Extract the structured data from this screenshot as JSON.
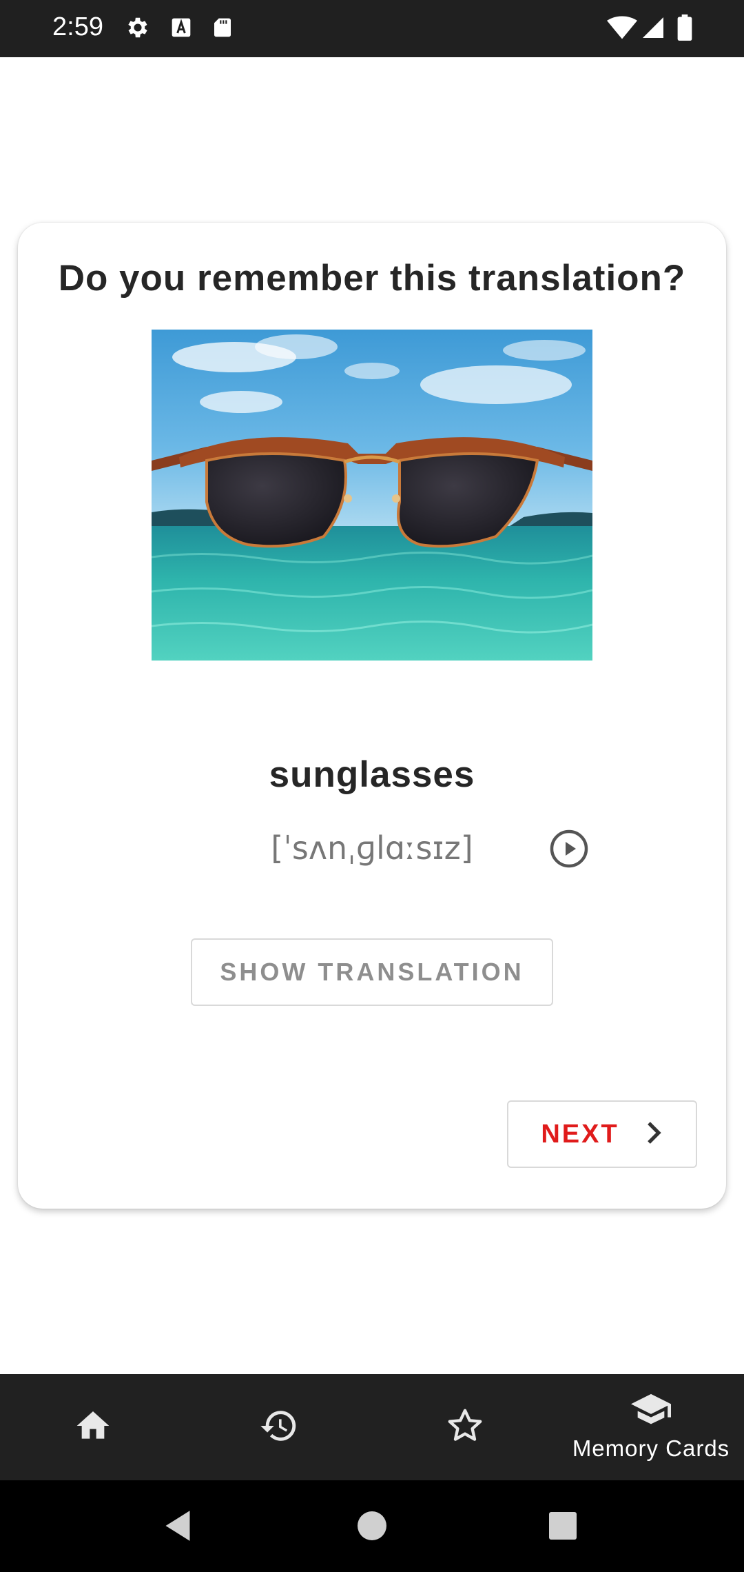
{
  "status_bar": {
    "time": "2:59",
    "icons": [
      "settings-gear-icon",
      "font-a-icon",
      "sd-card-icon",
      "wifi-icon",
      "cell-signal-icon",
      "battery-icon"
    ]
  },
  "card": {
    "question": "Do you remember this translation?",
    "image_subject": "sunglasses over sea",
    "word": "sunglasses",
    "phonetic": "[ˈsʌnˌɡlɑːsɪz]",
    "play_icon": "play-circle-icon",
    "show_translation_label": "SHOW TRANSLATION",
    "next_label": "NEXT",
    "next_icon": "chevron-right-icon"
  },
  "bottom_nav": {
    "items": [
      {
        "icon": "home-icon",
        "label": ""
      },
      {
        "icon": "history-icon",
        "label": ""
      },
      {
        "icon": "star-icon",
        "label": ""
      },
      {
        "icon": "graduation-cap-icon",
        "label": "Memory Cards"
      }
    ]
  },
  "system_nav": [
    "back-icon",
    "home-circle-icon",
    "recents-square-icon"
  ],
  "colors": {
    "accent": "#e01b1b",
    "status_bar": "#202020",
    "bottom_nav": "#212121",
    "system_nav": "#000000"
  }
}
